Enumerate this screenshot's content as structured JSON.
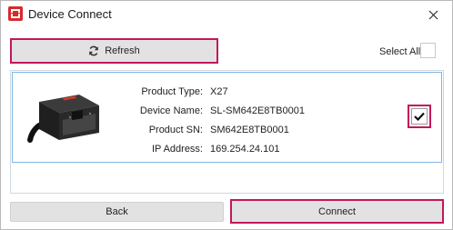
{
  "window": {
    "title": "Device Connect",
    "close_icon": "close-icon"
  },
  "toolbar": {
    "refresh_label": "Refresh",
    "refresh_icon": "refresh-icon",
    "select_all_label": "Select All",
    "select_all_checked": false
  },
  "device": {
    "fields": [
      {
        "label": "Product Type:",
        "value": "X27"
      },
      {
        "label": "Device Name:",
        "value": "SL-SM642E8TB0001"
      },
      {
        "label": "Product SN:",
        "value": "SM642E8TB0001"
      },
      {
        "label": "IP Address:",
        "value": "169.254.24.101"
      }
    ],
    "checked": true,
    "image": "barcode-scanner-module-image"
  },
  "footer": {
    "back_label": "Back",
    "connect_label": "Connect"
  },
  "colors": {
    "highlight": "#c2185b",
    "selection_border": "#7fb6e6",
    "button_bg": "#e2e2e2",
    "brand": "#d72b2b"
  }
}
